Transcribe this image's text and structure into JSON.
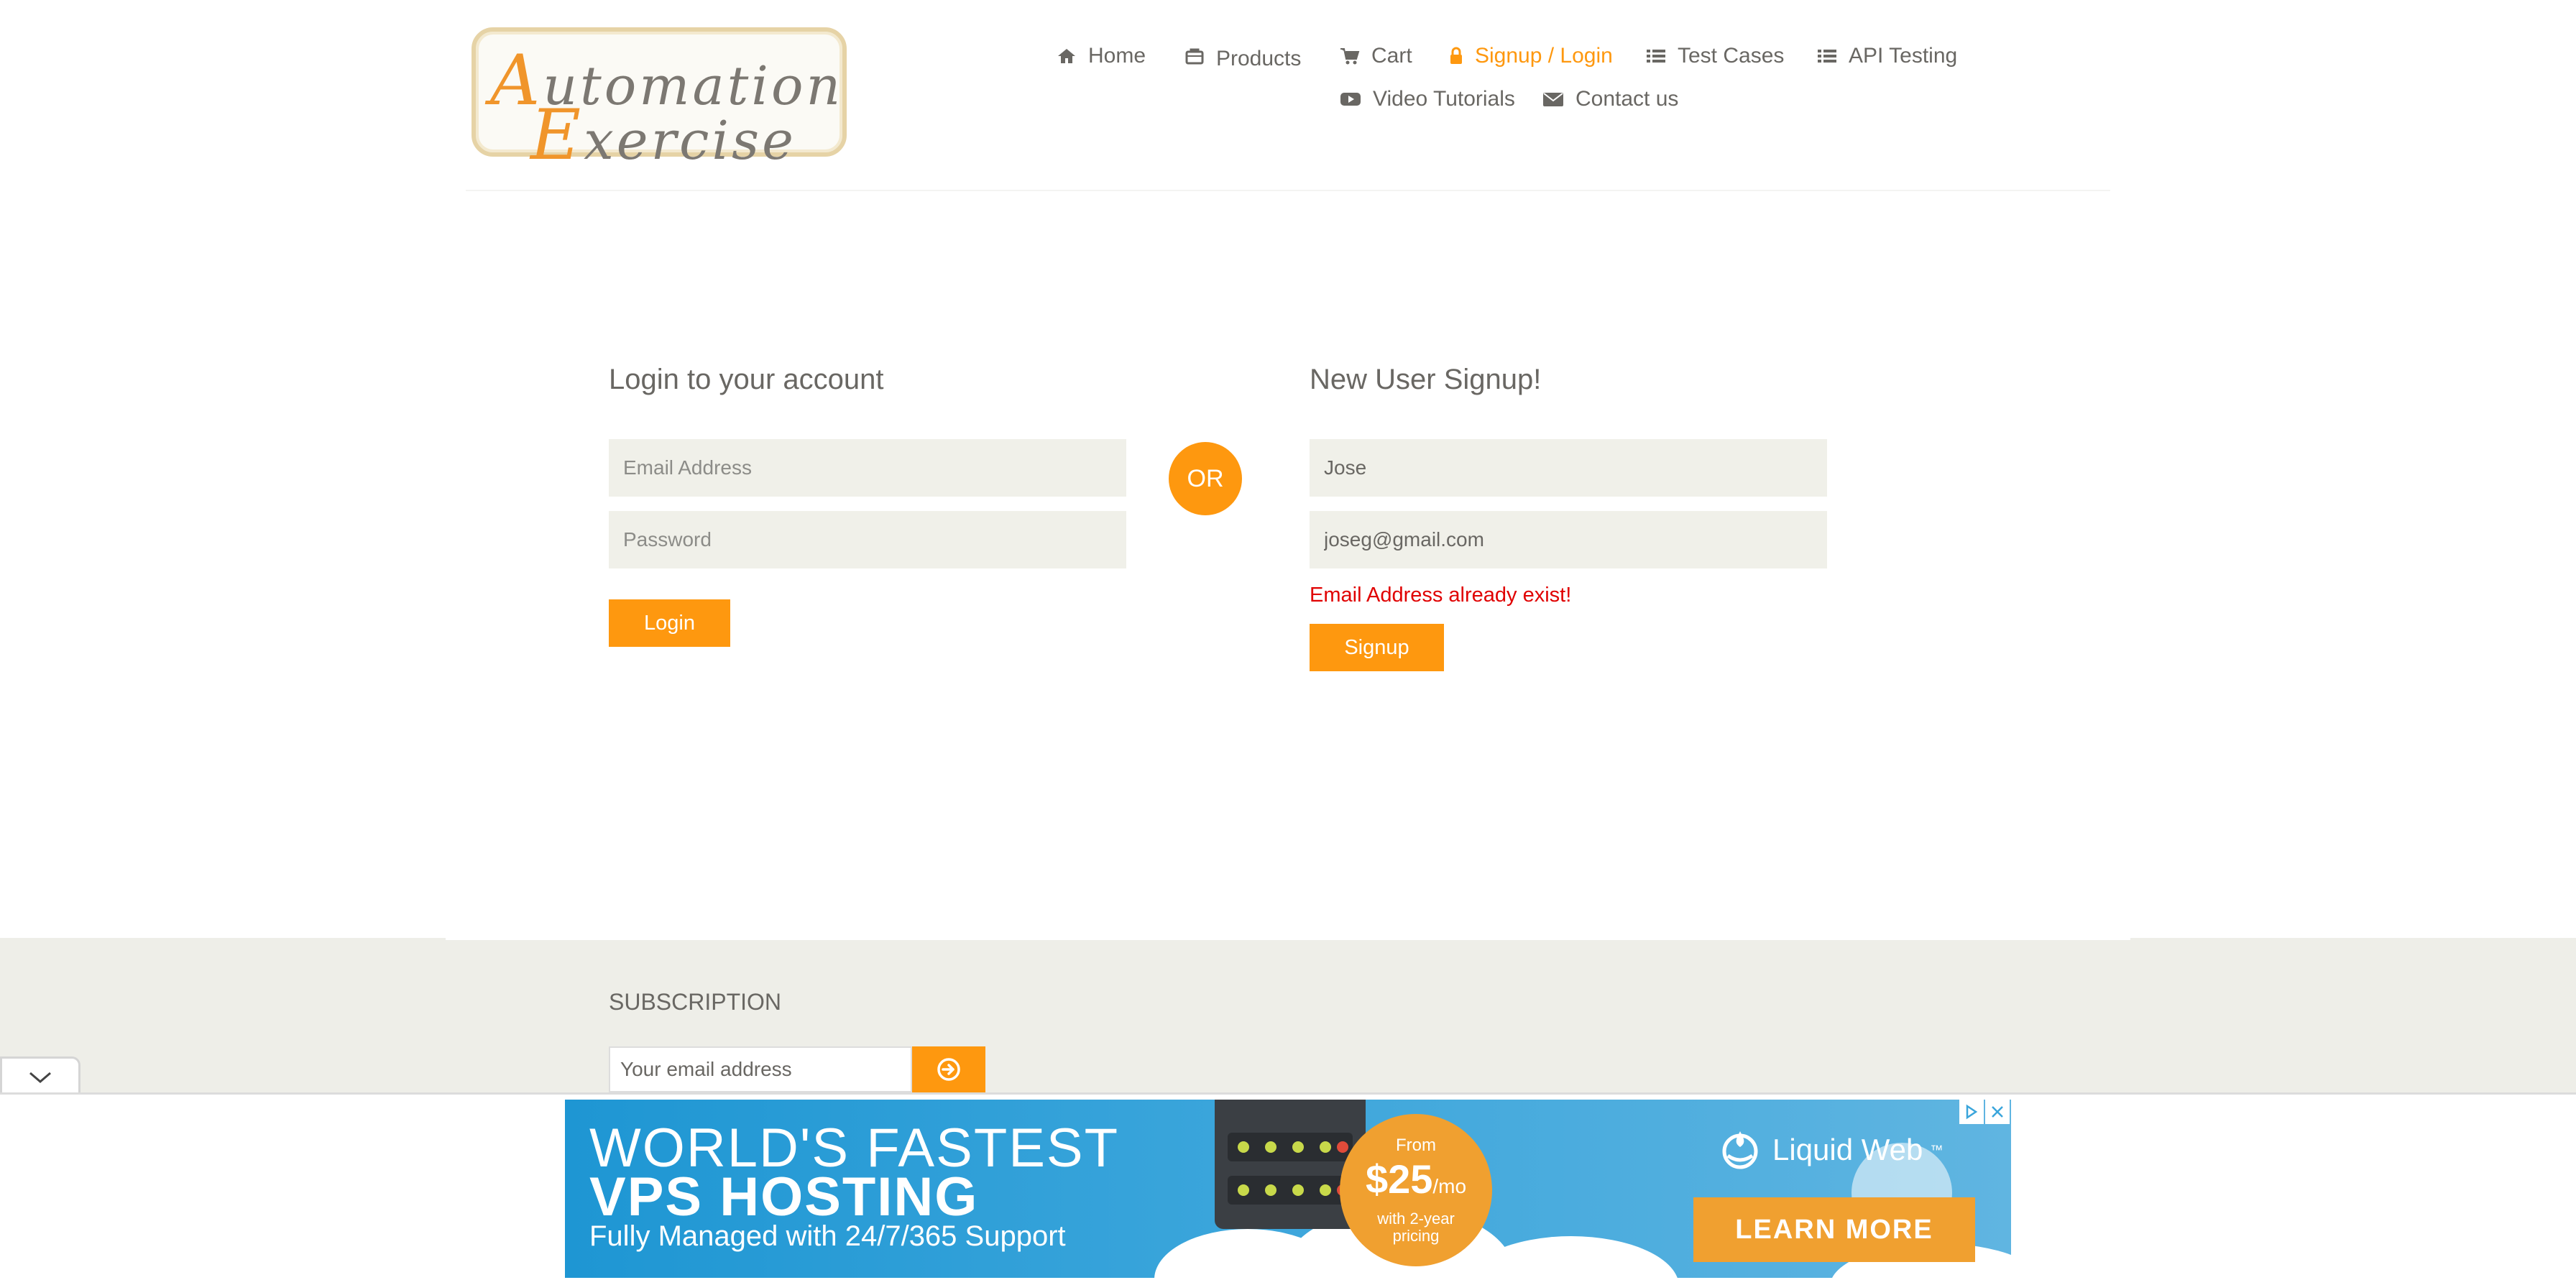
{
  "logo": {
    "line1_cap": "A",
    "line1_rest": "utomation",
    "line2_cap": "E",
    "line2_rest": "xercise"
  },
  "nav": {
    "items": [
      {
        "label": "Home",
        "icon": "home-icon"
      },
      {
        "label": "Products",
        "icon": "shopping-bag-icon"
      },
      {
        "label": "Cart",
        "icon": "cart-icon"
      },
      {
        "label": "Signup / Login",
        "icon": "lock-icon",
        "active": true
      },
      {
        "label": "Test Cases",
        "icon": "list-icon"
      },
      {
        "label": "API Testing",
        "icon": "list-icon"
      },
      {
        "label": "Video Tutorials",
        "icon": "youtube-icon"
      },
      {
        "label": "Contact us",
        "icon": "envelope-icon"
      }
    ]
  },
  "login": {
    "title": "Login to your account",
    "email_placeholder": "Email Address",
    "password_placeholder": "Password",
    "button": "Login"
  },
  "or_label": "OR",
  "signup": {
    "title": "New User Signup!",
    "name_value": "Jose",
    "email_value": "joseg@gmail.com",
    "error": "Email Address already exist!",
    "button": "Signup"
  },
  "subscription": {
    "title": "SUBSCRIPTION",
    "placeholder": "Your email address",
    "submit_icon": "arrow-circle-right-icon"
  },
  "ad": {
    "line1": "WORLD'S FASTEST",
    "line2": "VPS HOSTING",
    "line3": "Fully Managed with 24/7/365 Support",
    "price_from": "From",
    "price_amount": "$25",
    "price_unit": "/mo",
    "price_note_1": "with 2-year",
    "price_note_2": "pricing",
    "brand": "Liquid Web",
    "brand_tm": "™",
    "cta": "LEARN MORE"
  },
  "colors": {
    "accent": "#fe980f",
    "error": "#e00000",
    "field_bg": "#f0f0e9",
    "footer_bg": "#eeeee8"
  }
}
